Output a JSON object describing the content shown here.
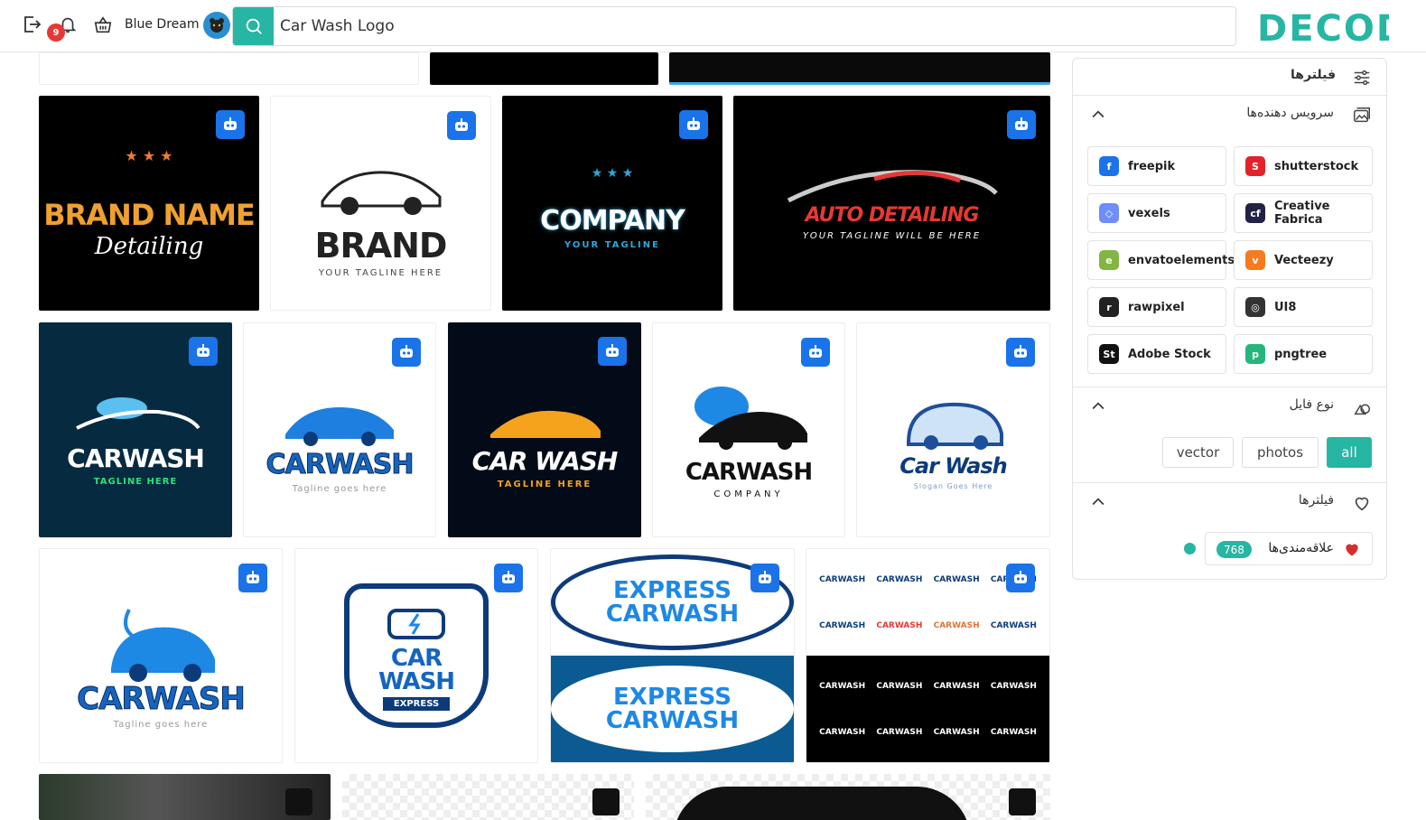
{
  "header": {
    "notification_count": "9",
    "username": "Blue Dream",
    "search_value": "Car Wash Logo",
    "logo_text": "DECOD"
  },
  "tiles": [
    {
      "title": "BRAND NAME",
      "subtitle": "Detailing",
      "bg": "#000000",
      "fg": "#f0a030"
    },
    {
      "title": "BRAND",
      "subtitle": "YOUR TAGLINE HERE",
      "bg": "#ffffff",
      "fg": "#222222"
    },
    {
      "title": "COMPANY",
      "subtitle": "YOUR TAGLINE",
      "bg": "#000000",
      "fg": "#ffffff"
    },
    {
      "title": "AUTO DETAILING",
      "subtitle": "YOUR TAGLINE WILL BE HERE",
      "bg": "#000000",
      "fg": "#e53935"
    },
    {
      "title": "CARWASH",
      "subtitle": "TAGLINE HERE",
      "bg": "#062a40",
      "fg": "#ffffff"
    },
    {
      "title": "CARWASH",
      "subtitle": "Tagline goes here",
      "bg": "#ffffff",
      "fg": "#1565c0"
    },
    {
      "title": "CAR WASH",
      "subtitle": "TAGLINE HERE",
      "bg": "#040b18",
      "fg": "#ffffff"
    },
    {
      "title": "CARWASH",
      "subtitle": "COMPANY",
      "bg": "#ffffff",
      "fg": "#111111"
    },
    {
      "title": "Car Wash",
      "subtitle": "Slogan Goes Here",
      "bg": "#ffffff",
      "fg": "#0d3b7a"
    },
    {
      "title": "CARWASH",
      "subtitle": "Tagline goes here",
      "bg": "#ffffff",
      "fg": "#1565c0"
    },
    {
      "title": "CAR WASH",
      "subtitle": "EXPRESS",
      "bg": "#ffffff",
      "fg": "#0d3b7a"
    },
    {
      "title": "EXPRESS CARWASH",
      "subtitle": "",
      "bg": "#0b5a92",
      "fg": "#ffffff"
    },
    {
      "title": "CARWASH",
      "subtitle": "",
      "bg": "#000000",
      "fg": "#ffffff"
    }
  ],
  "sidebar": {
    "filters_title": "فیلترها",
    "providers_title": "سرویس دهنده‌ها",
    "providers": [
      {
        "name": "freepik",
        "color": "#1a73e8",
        "glyph": "f"
      },
      {
        "name": "shutterstock",
        "color": "#e4222b",
        "glyph": "S"
      },
      {
        "name": "vexels",
        "color": "#6e8efb",
        "glyph": "◇"
      },
      {
        "name": "Creative Fabrica",
        "color": "#222244",
        "glyph": "cf"
      },
      {
        "name": "envatoelements",
        "color": "#82b541",
        "glyph": "e"
      },
      {
        "name": "Vecteezy",
        "color": "#f47b20",
        "glyph": "v"
      },
      {
        "name": "rawpixel",
        "color": "#222222",
        "glyph": "r"
      },
      {
        "name": "UI8",
        "color": "#333333",
        "glyph": "◎"
      },
      {
        "name": "Adobe Stock",
        "color": "#111111",
        "glyph": "St"
      },
      {
        "name": "pngtree",
        "color": "#26b67a",
        "glyph": "p"
      }
    ],
    "filetype_title": "نوع فایل",
    "filetypes": [
      "vector",
      "photos",
      "all"
    ],
    "filetype_selected": "all",
    "favorites_section_title": "فیلترها",
    "favorites_label": "علاقه‌مندی‌ها",
    "favorites_count": "768"
  }
}
